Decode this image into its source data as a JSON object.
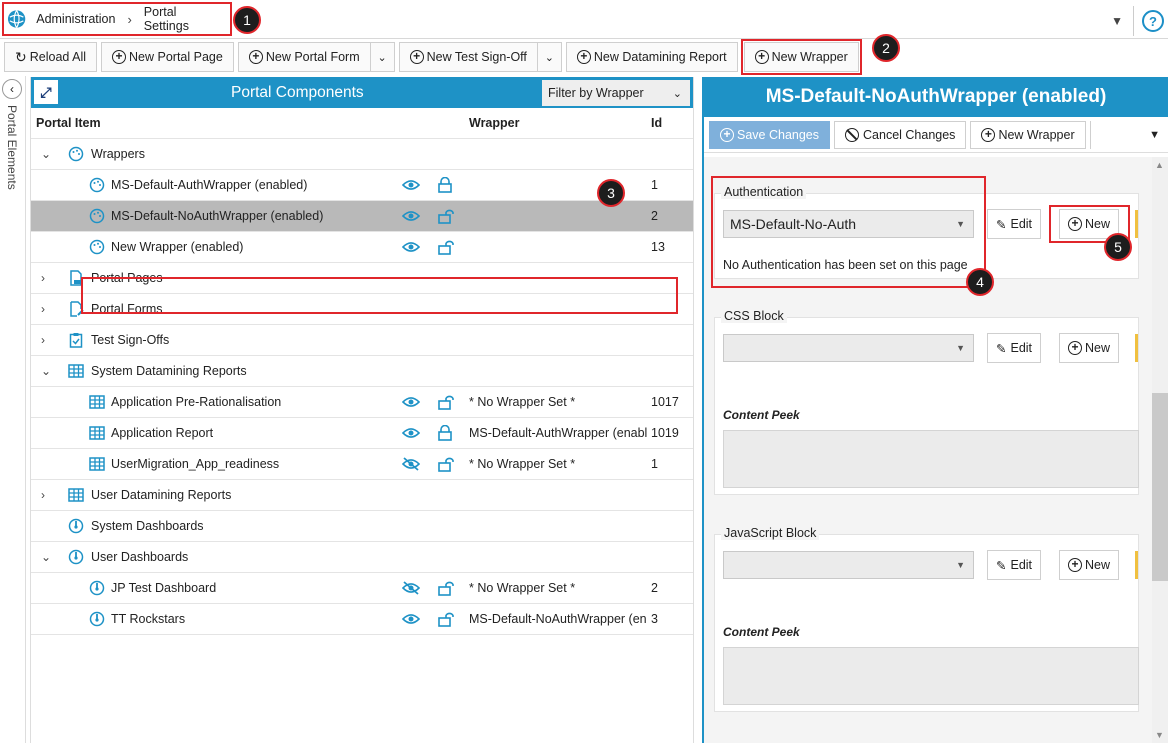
{
  "breadcrumb": [
    "Administration",
    "Portal Settings"
  ],
  "toolbar": {
    "reload": "Reload All",
    "new_page": "New Portal Page",
    "new_form": "New Portal Form",
    "new_signoff": "New Test Sign-Off",
    "new_report": "New Datamining Report",
    "new_wrapper": "New Wrapper"
  },
  "rail_label": "Portal Elements",
  "left": {
    "title": "Portal Components",
    "filter": "Filter by Wrapper",
    "columns": {
      "item": "Portal Item",
      "wrapper": "Wrapper",
      "id": "Id"
    },
    "rows": [
      {
        "label": "Wrappers"
      },
      {
        "label": "MS-Default-AuthWrapper (enabled)",
        "id": "1"
      },
      {
        "label": "MS-Default-NoAuthWrapper (enabled)",
        "id": "2"
      },
      {
        "label": "New Wrapper (enabled)",
        "id": "13"
      },
      {
        "label": "Portal Pages"
      },
      {
        "label": "Portal Forms"
      },
      {
        "label": "Test Sign-Offs"
      },
      {
        "label": "System Datamining Reports"
      },
      {
        "label": "Application Pre-Rationalisation",
        "wrapper": "* No Wrapper Set *",
        "id": "1017"
      },
      {
        "label": "Application Report",
        "wrapper": "MS-Default-AuthWrapper (enabl",
        "id": "1019"
      },
      {
        "label": "UserMigration_App_readiness",
        "wrapper": "* No Wrapper Set *",
        "id": "1"
      },
      {
        "label": "User Datamining Reports"
      },
      {
        "label": "System Dashboards"
      },
      {
        "label": "User Dashboards"
      },
      {
        "label": "JP Test Dashboard",
        "wrapper": "* No Wrapper Set *",
        "id": "2"
      },
      {
        "label": "TT Rockstars",
        "wrapper": "MS-Default-NoAuthWrapper (en",
        "id": "3"
      }
    ]
  },
  "right": {
    "title": "MS-Default-NoAuthWrapper (enabled)",
    "save": "Save Changes",
    "cancel": "Cancel Changes",
    "new_wrapper": "New Wrapper",
    "auth": {
      "title": "Authentication",
      "value": "MS-Default-No-Auth",
      "note": "No Authentication has been set on this page"
    },
    "css": {
      "title": "CSS Block"
    },
    "js": {
      "title": "JavaScript Block"
    },
    "edit": "Edit",
    "new": "New",
    "content_peek": "Content Peek"
  },
  "badges": [
    "1",
    "2",
    "3",
    "4",
    "5"
  ],
  "colors": {
    "accent": "#1e92c6",
    "highlight": "#e0262b"
  }
}
